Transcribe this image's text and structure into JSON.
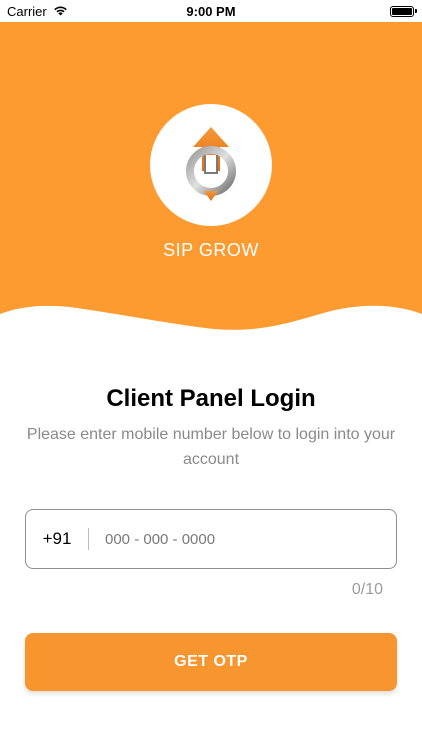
{
  "status_bar": {
    "carrier": "Carrier",
    "time": "9:00 PM",
    "wifi_icon": "wifi-icon",
    "battery_icon": "battery-icon"
  },
  "header": {
    "brand_name": "SIP GROW",
    "logo_icon": "sip-grow-logo",
    "background_color": "#fd9a30"
  },
  "login": {
    "title": "Client Panel Login",
    "subtitle": "Please enter mobile number below to login into your account",
    "country_code": "+91",
    "phone_placeholder": "000 - 000 - 0000",
    "phone_value": "",
    "char_counter": "0/10",
    "submit_label": "GET OTP",
    "accent_color": "#f7952e"
  }
}
